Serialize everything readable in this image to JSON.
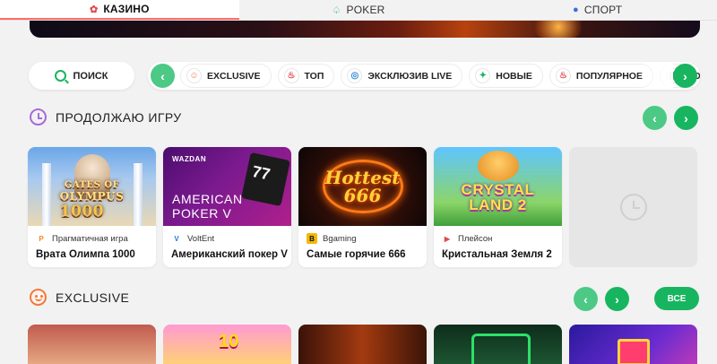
{
  "tabs": [
    {
      "label": "КАЗИНО",
      "icon": "casino-icon",
      "active": true
    },
    {
      "label": "POKER",
      "icon": "spade-icon",
      "active": false
    },
    {
      "label": "СПОРТ",
      "icon": "ball-icon",
      "active": false
    }
  ],
  "search": {
    "label": "ПОИСК"
  },
  "chips": [
    {
      "label": "EXCLUSIVE",
      "icon": "smile-icon",
      "glyph": "☺",
      "color": "#f17a3c"
    },
    {
      "label": "ТОП",
      "icon": "flame-icon",
      "glyph": "♨",
      "color": "#e5484d"
    },
    {
      "label": "ЭКСКЛЮЗИВ LIVE",
      "icon": "live-icon",
      "glyph": "◎",
      "color": "#2f8ad8"
    },
    {
      "label": "НОВЫЕ",
      "icon": "new-icon",
      "glyph": "✦",
      "color": "#18b560"
    },
    {
      "label": "ПОПУЛЯРНОЕ",
      "icon": "fire-icon",
      "glyph": "♨",
      "color": "#e5484d"
    },
    {
      "label": "НОЖОВКА",
      "icon": "slot-icon",
      "glyph": "▣",
      "color": "#444"
    }
  ],
  "sections": {
    "continue": {
      "title": "ПРОДОЛЖАЮ ИГРУ"
    },
    "exclusive": {
      "title": "EXCLUSIVE",
      "all_label": "ВСЕ"
    }
  },
  "games": [
    {
      "name": "Врата Олимпа 1000",
      "provider": "Прагматичная игра",
      "provider_color": "#f08a24",
      "provider_glyph": "P",
      "art": {
        "line1": "GATES OF",
        "line2": "OLYMPUS",
        "line3": "1000"
      }
    },
    {
      "name": "Американский покер V",
      "provider": "VoltEnt",
      "provider_color": "#2a7be4",
      "provider_glyph": "V",
      "art": {
        "brand": "WAZDAN",
        "line1": "AMERICAN",
        "line2": "POKER V"
      }
    },
    {
      "name": "Самые горячие 666",
      "provider": "Bgaming",
      "provider_color": "#f5b700",
      "provider_glyph": "B",
      "art": {
        "line1": "Hottest",
        "line2": "666"
      }
    },
    {
      "name": "Кристальная Земля 2",
      "provider": "Плейсон",
      "provider_color": "#e5484d",
      "provider_glyph": "▶",
      "art": {
        "line1": "CRYSTAL",
        "line2": "LAND 2"
      }
    }
  ],
  "colors": {
    "accent": "#18b560",
    "tab_active_underline": "#ff6b6b"
  }
}
